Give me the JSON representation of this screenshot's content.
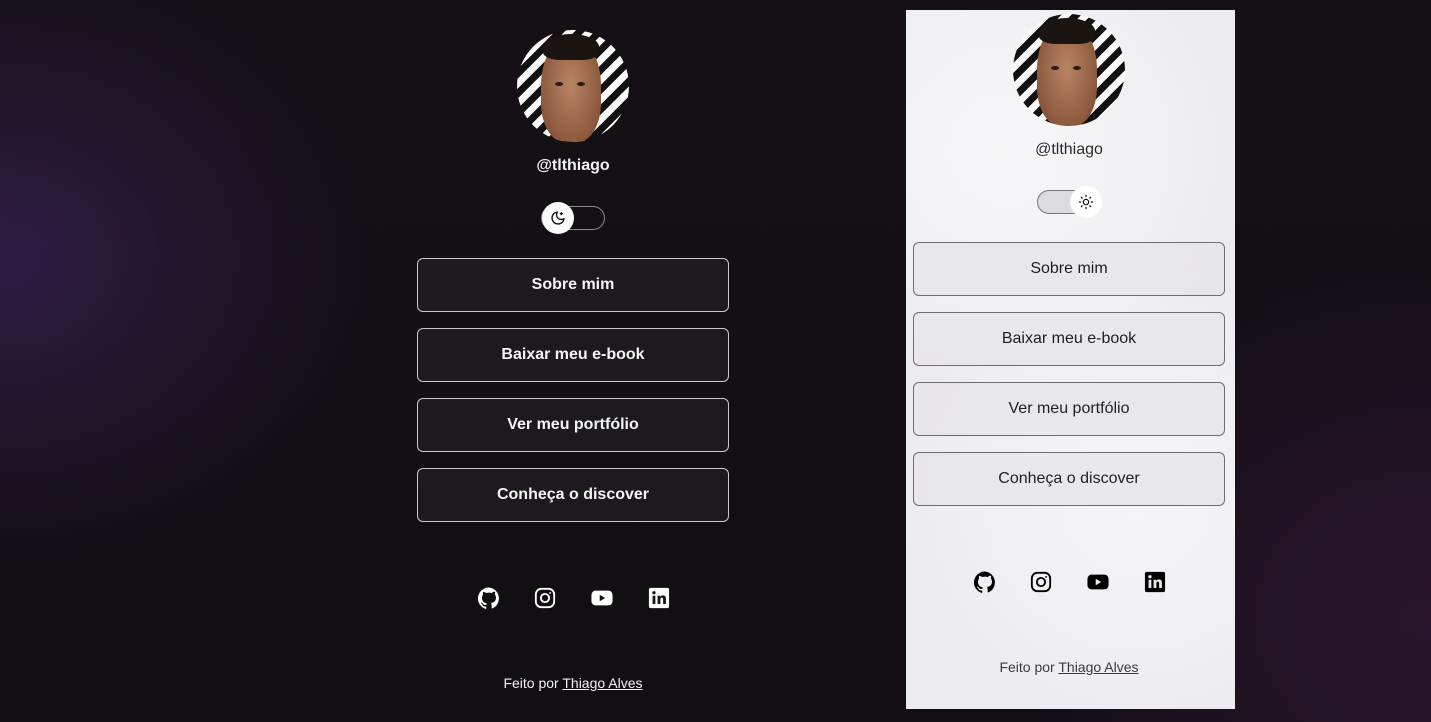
{
  "dark": {
    "handle": "@tlthiago",
    "theme_toggle": {
      "mode": "dark",
      "icon": "moon-icon"
    },
    "buttons": [
      {
        "label": "Sobre mim"
      },
      {
        "label": "Baixar meu e-book"
      },
      {
        "label": "Ver meu portfólio"
      },
      {
        "label": "Conheça o discover"
      }
    ],
    "social": [
      "github-icon",
      "instagram-icon",
      "youtube-icon",
      "linkedin-icon"
    ],
    "footer": {
      "prefix": "Feito por ",
      "author": "Thiago Alves"
    }
  },
  "light": {
    "handle": "@tlthiago",
    "theme_toggle": {
      "mode": "light",
      "icon": "sun-icon"
    },
    "buttons": [
      {
        "label": "Sobre mim"
      },
      {
        "label": "Baixar meu e-book"
      },
      {
        "label": "Ver meu portfólio"
      },
      {
        "label": "Conheça o discover"
      }
    ],
    "social": [
      "github-icon",
      "instagram-icon",
      "youtube-icon",
      "linkedin-icon"
    ],
    "footer": {
      "prefix": "Feito por ",
      "author": "Thiago Alves"
    }
  },
  "colors": {
    "dark_background": "#141016",
    "dark_button": "#1d1a1f",
    "light_panel": "#ecebef",
    "light_button": "#e6e5e9"
  }
}
